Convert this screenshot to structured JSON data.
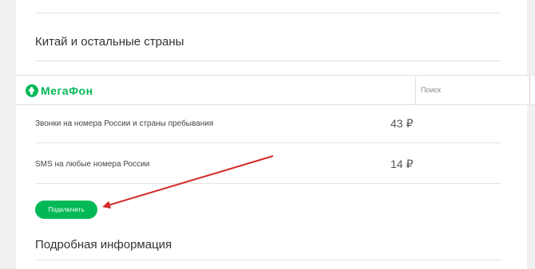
{
  "page": {
    "section_top_title": "Китай и остальные страны",
    "section_bottom_title": "Подробная информация"
  },
  "header": {
    "logo_text": "МегаФон",
    "logo_icon": "megafon-logo-icon",
    "search_placeholder": "Поиск",
    "search_value": ""
  },
  "tariff": {
    "rows": [
      {
        "label": "Звонки на номера России и страны пребывания",
        "price": "43 ₽"
      },
      {
        "label": "SMS на любые номера России",
        "price": "14 ₽"
      }
    ],
    "connect_label": "Подключить"
  },
  "annotation": {
    "arrow_color": "#d42a2a",
    "arrow_icon": "arrow-pointer-icon"
  },
  "colors": {
    "brand_green": "#00b956",
    "page_bg": "#f0f0f0",
    "card_bg": "#ffffff",
    "divider": "#e3e3e3"
  }
}
